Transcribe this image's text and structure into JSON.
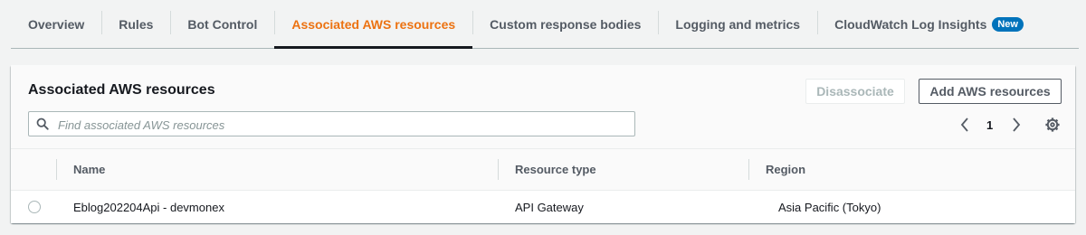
{
  "tabs": [
    {
      "label": "Overview"
    },
    {
      "label": "Rules"
    },
    {
      "label": "Bot Control"
    },
    {
      "label": "Associated AWS resources",
      "active": true
    },
    {
      "label": "Custom response bodies"
    },
    {
      "label": "Logging and metrics"
    },
    {
      "label": "CloudWatch Log Insights",
      "badge": "New"
    }
  ],
  "panel": {
    "title": "Associated AWS resources",
    "disassociate_label": "Disassociate",
    "add_label": "Add AWS resources",
    "search_placeholder": "Find associated AWS resources",
    "search_value": "",
    "current_page": "1"
  },
  "table": {
    "columns": [
      "Name",
      "Resource type",
      "Region"
    ],
    "rows": [
      {
        "name": "Eblog202204Api - devmonex",
        "resource_type": "API Gateway",
        "region": "Asia Pacific (Tokyo)"
      }
    ]
  },
  "icons": {
    "search": "search-icon",
    "prev": "chevron-left-icon",
    "next": "chevron-right-icon",
    "settings": "gear-icon"
  },
  "colors": {
    "active_tab": "#ec7211",
    "badge": "#0073bb",
    "disabled_text": "#aab7b8"
  }
}
